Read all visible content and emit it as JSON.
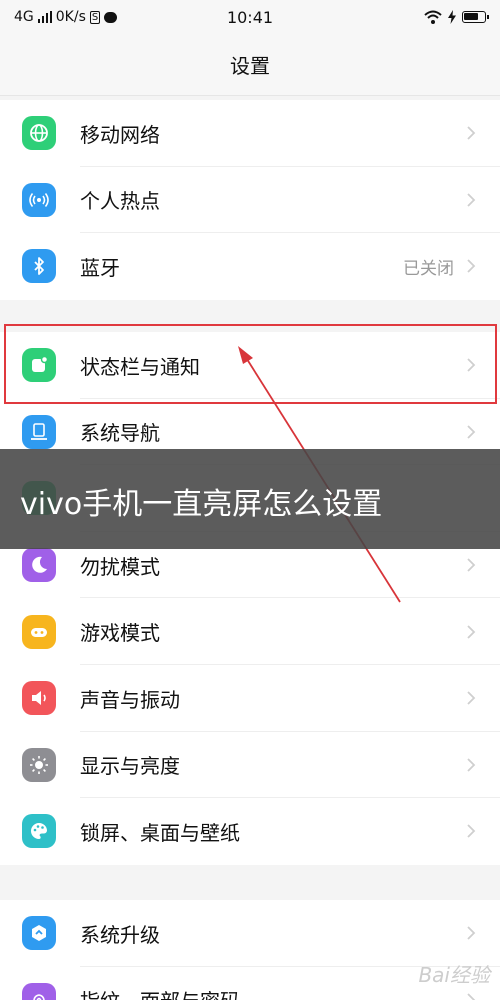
{
  "status_bar": {
    "network": "4G",
    "speed": "0K/s",
    "box_glyph": "S",
    "time": "10:41"
  },
  "header": {
    "title": "设置"
  },
  "groups": [
    {
      "items": [
        {
          "label": "移动网络",
          "icon": "globe-icon",
          "color": "#2ecf78"
        },
        {
          "label": "个人热点",
          "icon": "hotspot-icon",
          "color": "#2f9bf0"
        },
        {
          "label": "蓝牙",
          "icon": "bluetooth-icon",
          "color": "#2f9bf0",
          "value": "已关闭"
        }
      ]
    },
    {
      "items": [
        {
          "label": "状态栏与通知",
          "icon": "notification-icon",
          "color": "#2ecf78"
        },
        {
          "label": "系统导航",
          "icon": "navigation-icon",
          "color": "#2f9bf0"
        },
        {
          "label": "勿扰模式",
          "icon": "moon-icon",
          "color": "#a060e8"
        },
        {
          "label": "游戏模式",
          "icon": "gamepad-icon",
          "color": "#f7b51e"
        },
        {
          "label": "声音与振动",
          "icon": "speaker-icon",
          "color": "#f2555a"
        },
        {
          "label": "显示与亮度",
          "icon": "sun-icon",
          "color": "#8e8e93"
        },
        {
          "label": "锁屏、桌面与壁纸",
          "icon": "palette-icon",
          "color": "#2ec0c8"
        }
      ]
    },
    {
      "items": [
        {
          "label": "系统升级",
          "icon": "upgrade-icon",
          "color": "#2f9bf0"
        },
        {
          "label": "指纹、面部与密码",
          "icon": "fingerprint-icon",
          "color": "#a060e8"
        }
      ]
    }
  ],
  "overlay": {
    "caption": "vivo手机一直亮屏怎么设置"
  },
  "watermark": {
    "text": "Bai经验"
  },
  "colors": {
    "highlight": "#e0393e",
    "arrow": "#d8353a"
  }
}
